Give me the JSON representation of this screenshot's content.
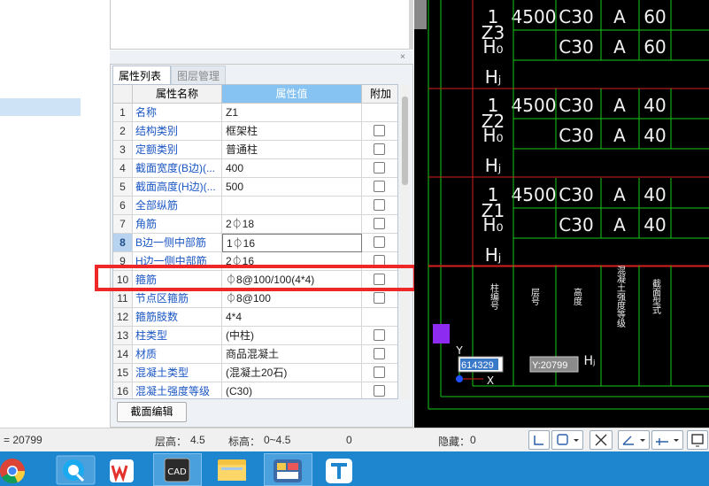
{
  "property_panel": {
    "tabs": [
      "属性列表",
      "图层管理"
    ],
    "close_symbol": "×",
    "headers": {
      "number": "",
      "name": "属性名称",
      "value": "属性值",
      "attach": "附加"
    },
    "rows": [
      {
        "num": "1",
        "name": "名称",
        "value": "Z1",
        "checkbox": false
      },
      {
        "num": "2",
        "name": "结构类别",
        "value": "框架柱",
        "checkbox": true
      },
      {
        "num": "3",
        "name": "定额类别",
        "value": "普通柱",
        "checkbox": true
      },
      {
        "num": "4",
        "name": "截面宽度(B边)(...",
        "value": "400",
        "checkbox": true
      },
      {
        "num": "5",
        "name": "截面高度(H边)(...",
        "value": "500",
        "checkbox": true
      },
      {
        "num": "6",
        "name": "全部纵筋",
        "value": "",
        "checkbox": true
      },
      {
        "num": "7",
        "name": "角筋",
        "value": "2⏀18",
        "checkbox": true
      },
      {
        "num": "8",
        "name": "B边一侧中部筋",
        "value": "1⏀16",
        "checkbox": true
      },
      {
        "num": "9",
        "name": "H边一侧中部筋",
        "value": "2⏀16",
        "checkbox": true
      },
      {
        "num": "10",
        "name": "箍筋",
        "value": "⏀8@100/100(4*4)",
        "checkbox": true
      },
      {
        "num": "11",
        "name": "节点区箍筋",
        "value": "⏀8@100",
        "checkbox": true
      },
      {
        "num": "12",
        "name": "箍筋肢数",
        "value": "4*4",
        "checkbox": false
      },
      {
        "num": "13",
        "name": "柱类型",
        "value": "(中柱)",
        "checkbox": true
      },
      {
        "num": "14",
        "name": "材质",
        "value": "商品混凝土",
        "checkbox": true
      },
      {
        "num": "15",
        "name": "混凝土类型",
        "value": "(混凝土20石)",
        "checkbox": true
      },
      {
        "num": "16",
        "name": "混凝土强度等级",
        "value": "(C30)",
        "checkbox": true
      }
    ],
    "selected_row": "8",
    "highlighted_row": "10",
    "section_edit_button": "截面编辑"
  },
  "cad": {
    "colors": {
      "background": "#000000",
      "red": "#d42020",
      "green": "#17c817",
      "text": "#f2f2f2",
      "purple": "#8e2bf0"
    },
    "row_groups": [
      {
        "label": "Z3",
        "rows": [
          [
            "1",
            "4500",
            "C30",
            "A",
            "60"
          ],
          [
            "H₀",
            "",
            "C30",
            "A",
            "60"
          ],
          [
            "Hⱼ",
            "",
            "",
            "",
            ""
          ]
        ]
      },
      {
        "label": "Z2",
        "rows": [
          [
            "1",
            "4500",
            "C30",
            "A",
            "40"
          ],
          [
            "H₀",
            "",
            "C30",
            "A",
            "40"
          ],
          [
            "Hⱼ",
            "",
            "",
            "",
            ""
          ]
        ]
      },
      {
        "label": "Z1",
        "rows": [
          [
            "1",
            "4500",
            "C30",
            "A",
            "40"
          ],
          [
            "H₀",
            "",
            "C30",
            "A",
            "40"
          ],
          [
            "Hⱼ",
            "",
            "",
            "",
            ""
          ]
        ]
      }
    ],
    "header_labels": [
      "柱编号",
      "层号",
      "高度",
      "混凝土强度等级",
      "截面型式"
    ],
    "coord_x": "614329",
    "coord_y": "Y:20799",
    "axis_y": "Y",
    "axis_x": "X",
    "stray_h": "Hⱼ"
  },
  "status_bar": {
    "coord": "= 20799",
    "floor_height_label": "层高：",
    "floor_height": "4.5",
    "elevation_label": "标高：",
    "elevation": "0~4.5",
    "zero": "0",
    "hidden_label": "隐藏：",
    "hidden_count": "0"
  },
  "taskbar": {
    "items": [
      "chrome",
      "browser",
      "wps",
      "cad",
      "file-explorer",
      "app",
      "text-app"
    ],
    "cad_label": "CAD"
  }
}
